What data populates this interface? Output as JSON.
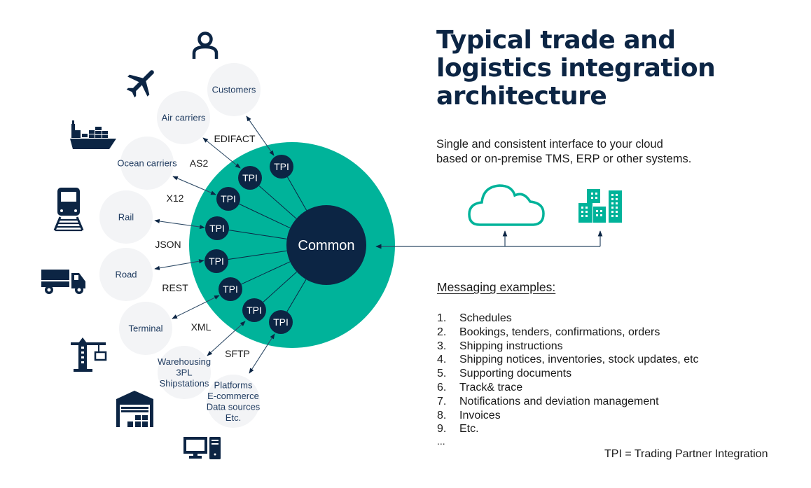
{
  "title": {
    "lines": [
      "Typical trade and",
      "logistics integration",
      "architecture"
    ]
  },
  "subtitle": {
    "lines": [
      "Single and consistent interface to your cloud",
      "based or on-premise TMS, ERP or other systems."
    ]
  },
  "hub": {
    "label": "Common",
    "tpi_label": "TPI"
  },
  "partners": [
    {
      "id": "customers",
      "lines": [
        "Customers"
      ],
      "icon": "person-icon"
    },
    {
      "id": "air-carriers",
      "lines": [
        "Air carriers"
      ],
      "icon": "airplane-icon"
    },
    {
      "id": "ocean-carriers",
      "lines": [
        "Ocean carriers"
      ],
      "icon": "ship-icon"
    },
    {
      "id": "rail",
      "lines": [
        "Rail"
      ],
      "icon": "train-icon"
    },
    {
      "id": "road",
      "lines": [
        "Road"
      ],
      "icon": "truck-icon"
    },
    {
      "id": "terminal",
      "lines": [
        "Terminal"
      ],
      "icon": "crane-icon"
    },
    {
      "id": "warehousing",
      "lines": [
        "Warehousing",
        "3PL",
        "Shipstations"
      ],
      "icon": "warehouse-icon"
    },
    {
      "id": "platforms",
      "lines": [
        "Platforms",
        "E-commerce",
        "Data sources",
        "Etc."
      ],
      "icon": "computer-icon"
    }
  ],
  "protocols": [
    "EDIFACT",
    "AS2",
    "X12",
    "JSON",
    "REST",
    "XML",
    "SFTP"
  ],
  "systems": [
    {
      "id": "cloud",
      "icon": "cloud-icon"
    },
    {
      "id": "on-premise",
      "icon": "buildings-icon"
    }
  ],
  "messaging": {
    "heading": "Messaging examples:",
    "items": [
      {
        "num": "1.",
        "text": "Schedules"
      },
      {
        "num": "2.",
        "text": "Bookings, tenders, confirmations, orders"
      },
      {
        "num": "3.",
        "text": "Shipping instructions"
      },
      {
        "num": "4.",
        "text": "Shipping notices, inventories, stock updates, etc"
      },
      {
        "num": "5.",
        "text": "Supporting documents"
      },
      {
        "num": "6.",
        "text": "Track& trace"
      },
      {
        "num": "7.",
        "text": "Notifications and deviation management"
      },
      {
        "num": "8.",
        "text": "Invoices"
      },
      {
        "num": "9.",
        "text": "Etc."
      }
    ],
    "ellipsis": "..."
  },
  "legend": "TPI = Trading Partner Integration",
  "colors": {
    "navy": "#0c2544",
    "teal": "#00b39a",
    "partner_bg": "#f3f4f6",
    "arrow": "#2e4a66"
  }
}
